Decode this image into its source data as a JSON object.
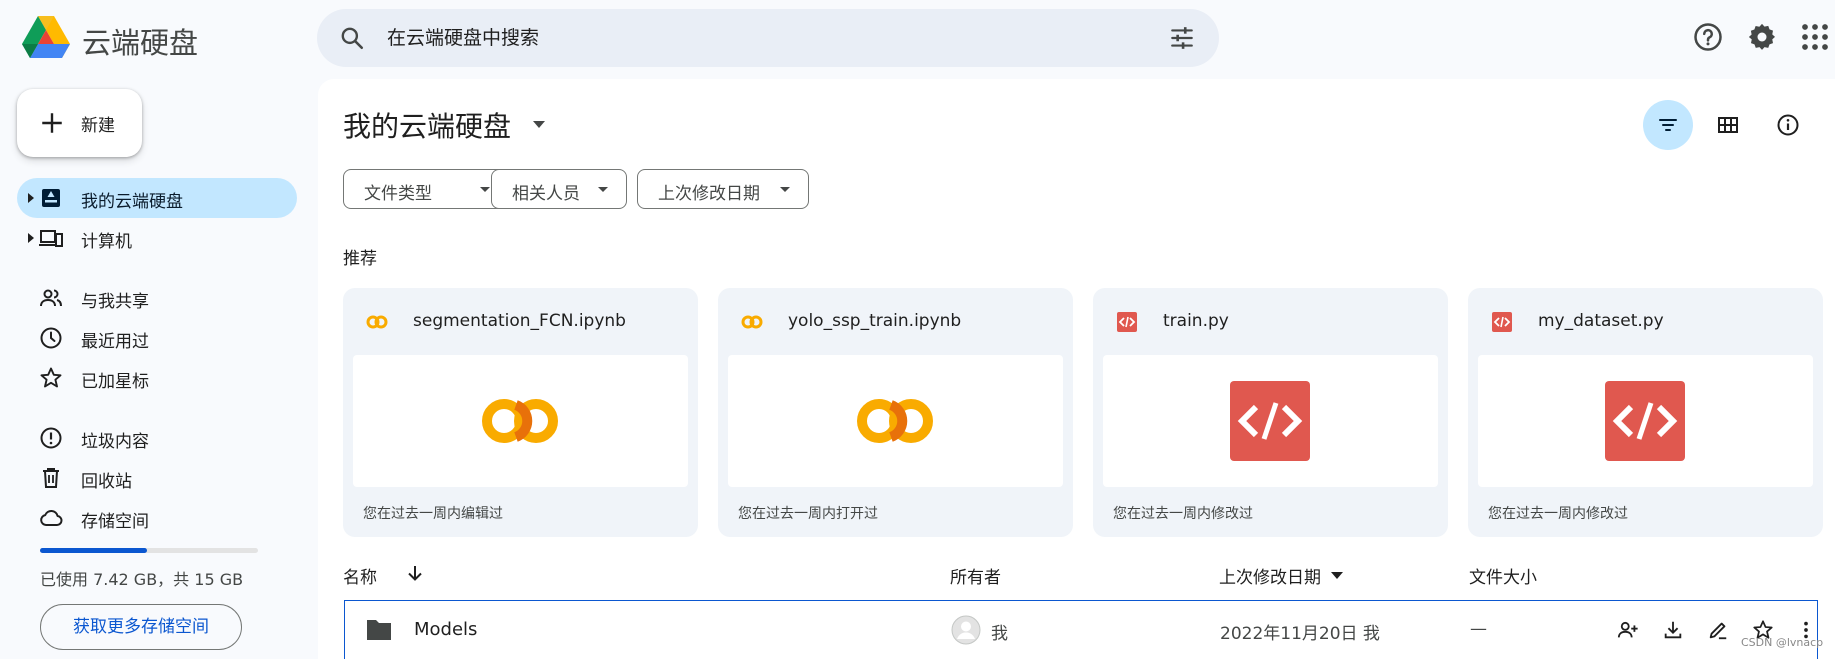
{
  "header": {
    "app_title": "云端硬盘",
    "search_placeholder": "在云端硬盘中搜索"
  },
  "sidebar": {
    "new_label": "新建",
    "items": [
      {
        "label": "我的云端硬盘",
        "icon": "my-drive-icon",
        "active": true
      },
      {
        "label": "计算机",
        "icon": "computers-icon"
      },
      {
        "label": "与我共享",
        "icon": "shared-people-icon"
      },
      {
        "label": "最近用过",
        "icon": "clock-icon"
      },
      {
        "label": "已加星标",
        "icon": "star-icon"
      },
      {
        "label": "垃圾内容",
        "icon": "spam-icon"
      },
      {
        "label": "回收站",
        "icon": "trash-icon"
      },
      {
        "label": "存储空间",
        "icon": "cloud-icon"
      }
    ],
    "storage_used_fraction": 0.49,
    "storage_text": "已使用 7.42 GB，共 15 GB",
    "get_storage_label": "获取更多存储空间"
  },
  "main": {
    "title": "我的云端硬盘",
    "filters": [
      "文件类型",
      "相关人员",
      "上次修改日期"
    ],
    "suggested_label": "推荐",
    "cards": [
      {
        "name": "segmentation_FCN.ipynb",
        "type": "colab",
        "reason": "您在过去一周内编辑过"
      },
      {
        "name": "yolo_ssp_train.ipynb",
        "type": "colab",
        "reason": "您在过去一周内打开过"
      },
      {
        "name": "train.py",
        "type": "code",
        "reason": "您在过去一周内修改过"
      },
      {
        "name": "my_dataset.py",
        "type": "code",
        "reason": "您在过去一周内修改过"
      }
    ],
    "columns": {
      "name": "名称",
      "owner": "所有者",
      "modified": "上次修改日期",
      "size": "文件大小"
    },
    "rows": [
      {
        "name": "Models",
        "owner": "我",
        "modified": "2022年11月20日 我",
        "size": "—"
      }
    ]
  },
  "watermark": "CSDN @lvnacp",
  "colors": {
    "accent": "#0b57d0",
    "active_bg": "#c2e7ff",
    "code_red": "#e0584f",
    "colab_yellow": "#f9ab00"
  }
}
